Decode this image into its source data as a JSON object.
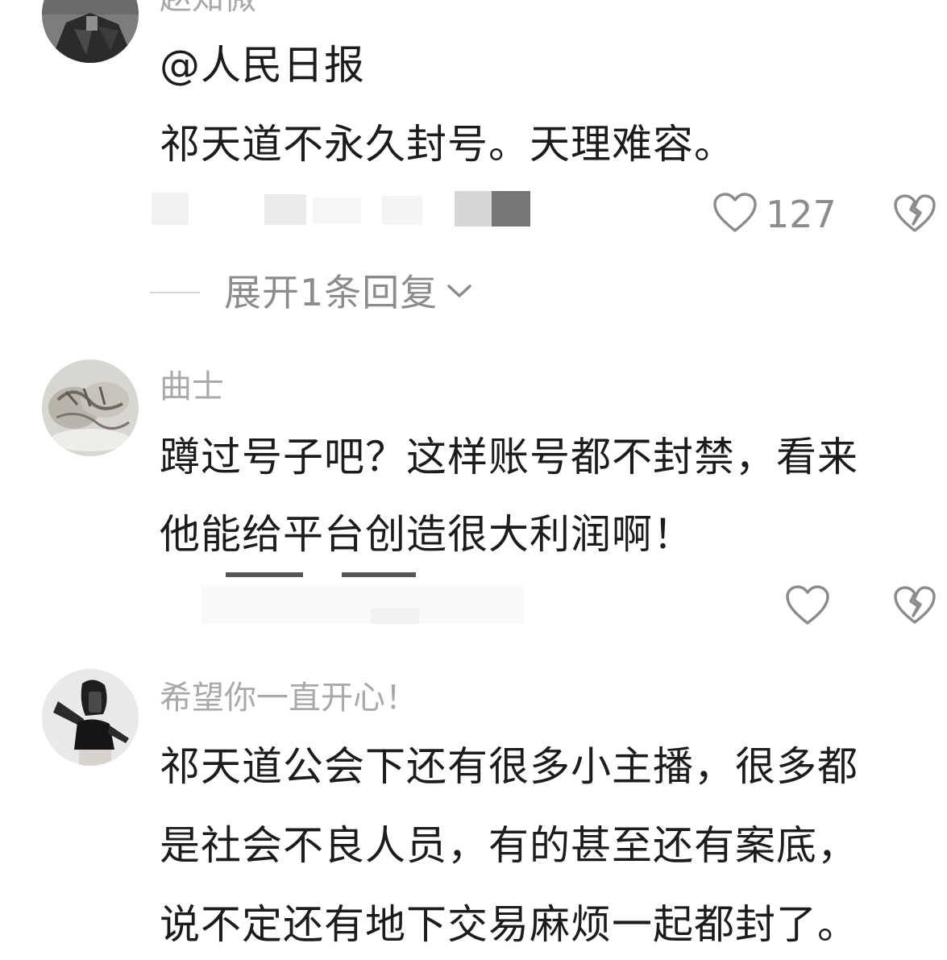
{
  "comments": [
    {
      "username": "赵知微",
      "lines": [
        "@人民日报",
        "祁天道不永久封号。天理难容。"
      ],
      "likes": "127",
      "expand_label": "展开1条回复"
    },
    {
      "username": "曲士",
      "lines": [
        "蹲过号子吧？这样账号都不封禁，看来",
        "他能给平台创造很大利润啊！"
      ],
      "likes": ""
    },
    {
      "username": "希望你一直开心！",
      "lines": [
        "祁天道公会下还有很多小主播，很多都",
        "是社会不良人员，有的甚至还有案底，",
        "说不定还有地下交易麻烦一起都封了。"
      ]
    }
  ],
  "icons": {
    "like": "heart-outline-icon",
    "dislike": "broken-heart-icon",
    "expand": "chevron-down-icon"
  },
  "colors": {
    "text": "#1c1c1c",
    "muted": "#8c8c8c",
    "username": "#a9a9a9"
  }
}
